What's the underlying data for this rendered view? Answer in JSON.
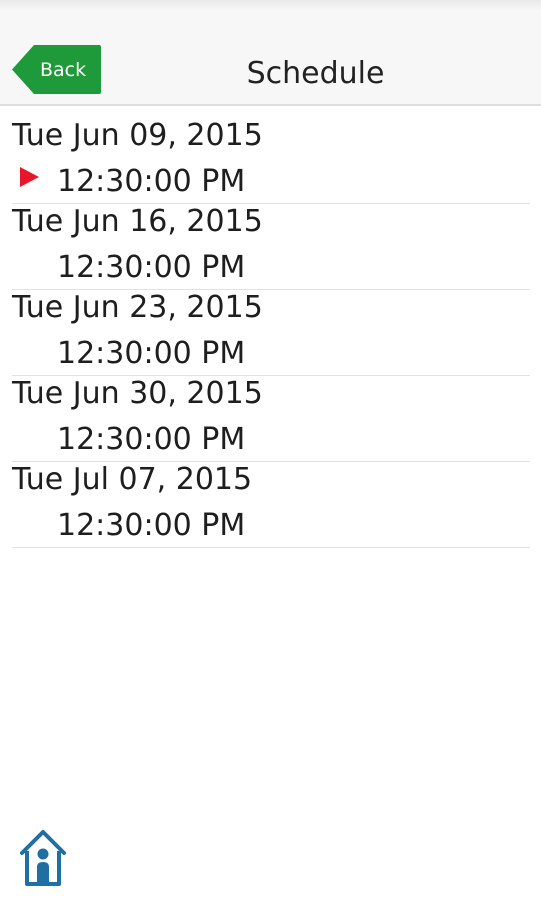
{
  "header": {
    "title": "Schedule",
    "back_label": "Back",
    "back_color": "#1f9a3a"
  },
  "schedule": [
    {
      "date": "Tue Jun 09, 2015",
      "time": "12:30:00 PM",
      "current": true
    },
    {
      "date": "Tue Jun 16, 2015",
      "time": "12:30:00 PM",
      "current": false
    },
    {
      "date": "Tue Jun 23, 2015",
      "time": "12:30:00 PM",
      "current": false
    },
    {
      "date": "Tue Jun 30, 2015",
      "time": "12:30:00 PM",
      "current": false
    },
    {
      "date": "Tue Jul 07, 2015",
      "time": "12:30:00 PM",
      "current": false
    }
  ],
  "colors": {
    "marker": "#e8162b",
    "home_icon": "#1f6fa3"
  },
  "icons": {
    "current": "play-triangle",
    "home": "house-with-person"
  }
}
